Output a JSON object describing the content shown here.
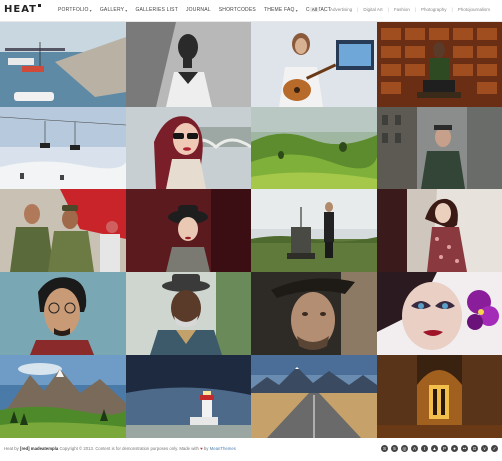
{
  "header": {
    "logo": "HEAT",
    "nav": [
      {
        "label": "PORTFOLIO",
        "dropdown": true
      },
      {
        "label": "GALLERY",
        "dropdown": true
      },
      {
        "label": "GALLERIES LIST",
        "dropdown": false
      },
      {
        "label": "JOURNAL",
        "dropdown": false
      },
      {
        "label": "SHORTCODES",
        "dropdown": false
      },
      {
        "label": "THEME FAQ",
        "dropdown": true
      },
      {
        "label": "CONTACT",
        "dropdown": false
      }
    ],
    "filters": [
      "All",
      "Advertising",
      "Digital Art",
      "Fashion",
      "Photography",
      "Photojournalism"
    ],
    "active_filter": "All"
  },
  "grid": {
    "tiles": [
      {
        "subject": "harbor with boats"
      },
      {
        "subject": "black and white portrait"
      },
      {
        "subject": "woman with guitar"
      },
      {
        "subject": "man seated by brick wall"
      },
      {
        "subject": "ski lift over snow"
      },
      {
        "subject": "woman with sunglasses by bridge"
      },
      {
        "subject": "green hills landscape"
      },
      {
        "subject": "man in city street"
      },
      {
        "subject": "soldiers in camouflage"
      },
      {
        "subject": "woman in hat"
      },
      {
        "subject": "man by old machine in field"
      },
      {
        "subject": "woman in floral dress"
      },
      {
        "subject": "man with round glasses"
      },
      {
        "subject": "elderly man in hat"
      },
      {
        "subject": "man in fedora close-up"
      },
      {
        "subject": "woman with purple orchid"
      },
      {
        "subject": "mountain meadow"
      },
      {
        "subject": "lighthouse under sky"
      },
      {
        "subject": "road to mountains"
      },
      {
        "subject": "church interior"
      }
    ]
  },
  "footer": {
    "made_by": "Heat by",
    "brand": "[red] madeatempla",
    "copyright": "Copyright © 2013. Content is for demonstration purposes only. Made with",
    "by": "by",
    "author": "MeanThemes",
    "social_icons": [
      "skype-icon",
      "500px-icon",
      "instagram-icon",
      "app-net-icon",
      "tumblr-icon",
      "forrst-icon",
      "pinterest-icon",
      "dribbble-icon",
      "flickr-icon",
      "github-icon",
      "vimeo-icon",
      "twitter-icon"
    ]
  }
}
